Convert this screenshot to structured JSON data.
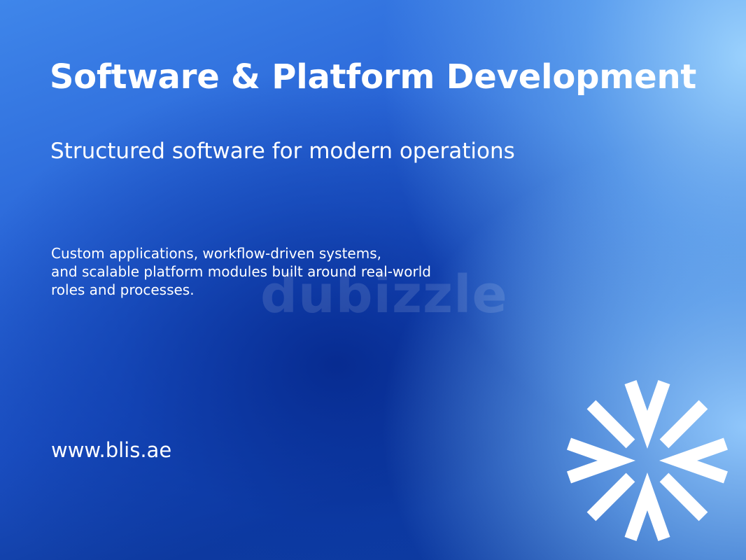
{
  "header": {
    "title": "Software & Platform Development",
    "subtitle": "Structured software for modern operations"
  },
  "main": {
    "description_lines": [
      "Custom applications, workflow-driven systems,",
      "and scalable platform modules built around real-world",
      "roles and processes."
    ]
  },
  "watermark": {
    "text": "dubizzle"
  },
  "footer": {
    "website": "www.blis.ae",
    "logo_icon": "blis-logo-icon"
  },
  "colors": {
    "text": "#ffffff",
    "background_dark": "#0e3a9e",
    "background_light": "#9fd3ff"
  }
}
